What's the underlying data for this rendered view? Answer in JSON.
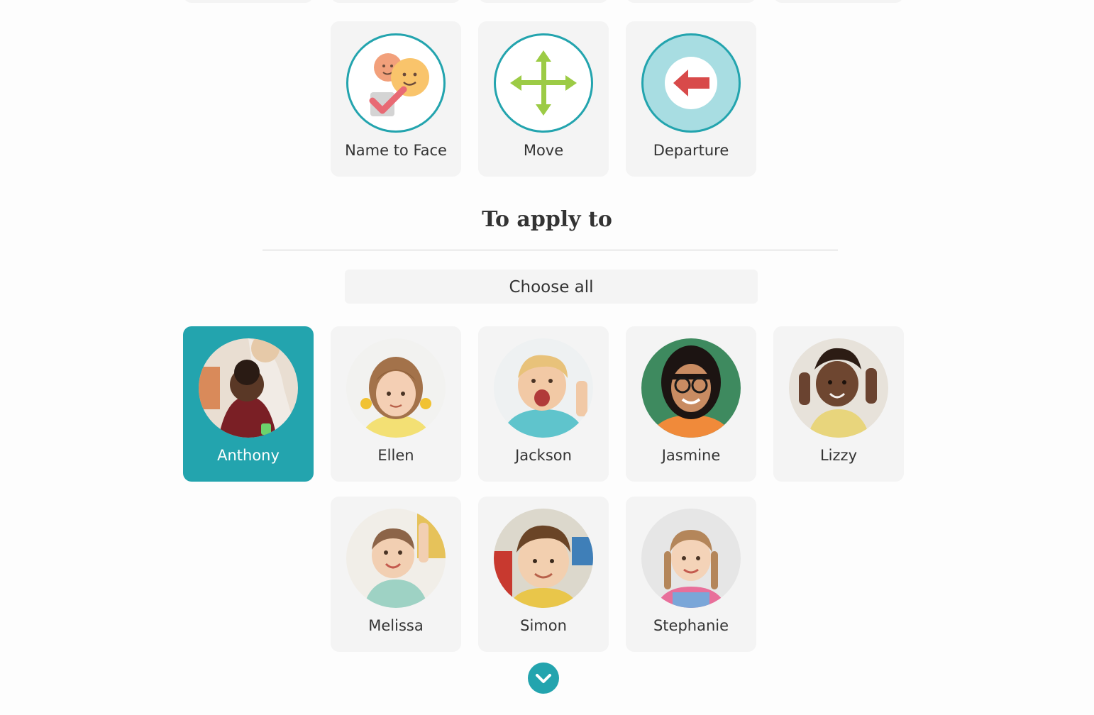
{
  "activities": [
    {
      "label": "Name to Face",
      "icon": "name-to-face-icon"
    },
    {
      "label": "Move",
      "icon": "move-arrows-icon"
    },
    {
      "label": "Departure",
      "icon": "departure-arrow-icon"
    }
  ],
  "apply_section": {
    "title": "To apply to",
    "choose_all_label": "Choose all"
  },
  "children": [
    {
      "name": "Anthony",
      "selected": true
    },
    {
      "name": "Ellen",
      "selected": false
    },
    {
      "name": "Jackson",
      "selected": false
    },
    {
      "name": "Jasmine",
      "selected": false
    },
    {
      "name": "Lizzy",
      "selected": false
    },
    {
      "name": "Melissa",
      "selected": false
    },
    {
      "name": "Simon",
      "selected": false
    },
    {
      "name": "Stephanie",
      "selected": false
    }
  ],
  "colors": {
    "accent": "#23a4ae",
    "card_bg": "#f4f4f4",
    "move_arrow": "#9ccb45",
    "departure_arrow": "#d84a4a"
  },
  "scroll_icon": "chevron-down-icon"
}
